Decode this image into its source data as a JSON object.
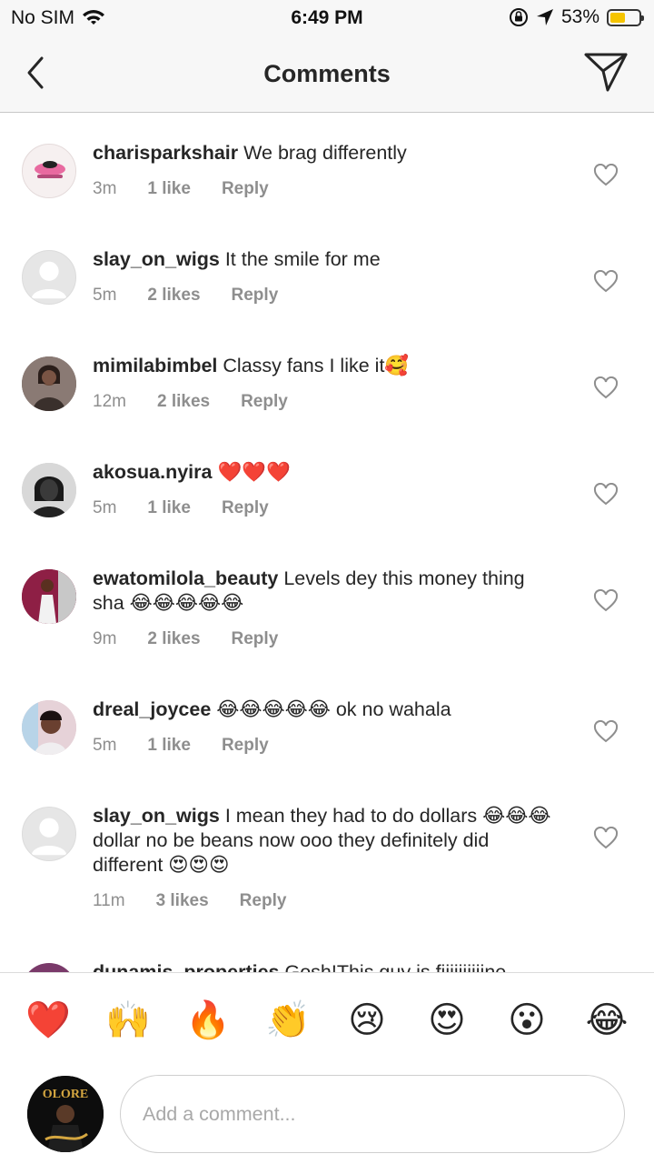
{
  "status_bar": {
    "carrier": "No SIM",
    "time": "6:49 PM",
    "battery_percent": "53%",
    "battery_level": 0.53
  },
  "nav": {
    "title": "Comments"
  },
  "comments": [
    {
      "username": "charisparkshair",
      "text": "We brag differently",
      "time": "3m",
      "likes": "1 like",
      "reply": "Reply"
    },
    {
      "username": "slay_on_wigs",
      "text": "It the smile for me",
      "time": "5m",
      "likes": "2 likes",
      "reply": "Reply"
    },
    {
      "username": "mimilabimbel",
      "text": "Classy fans I like it🥰",
      "time": "12m",
      "likes": "2 likes",
      "reply": "Reply"
    },
    {
      "username": "akosua.nyira",
      "text": "❤️❤️❤️",
      "time": "5m",
      "likes": "1 like",
      "reply": "Reply"
    },
    {
      "username": "ewatomilola_beauty",
      "text": "Levels dey this money thing sha 😂😂😂😂😂",
      "time": "9m",
      "likes": "2 likes",
      "reply": "Reply"
    },
    {
      "username": "dreal_joycee",
      "text": "😂😂😂😂😂 ok no wahala",
      "time": "5m",
      "likes": "1 like",
      "reply": "Reply"
    },
    {
      "username": "slay_on_wigs",
      "text": "I mean they had to do dollars 😂😂😂dollar no be beans now ooo they definitely did different 😍😍😍",
      "time": "11m",
      "likes": "3 likes",
      "reply": "Reply"
    },
    {
      "username": "dunamis_properties",
      "text": "Gosh!This guy is fiiiiiiiiiine"
    }
  ],
  "quick_reactions": [
    "❤️",
    "🙌",
    "🔥",
    "👏",
    "😢",
    "😍",
    "😮",
    "😂"
  ],
  "composer": {
    "placeholder": "Add a comment...",
    "avatar_text": "OLORE"
  },
  "colors": {
    "secondary_text": "#8e8e8e",
    "battery": "#f5c400"
  }
}
